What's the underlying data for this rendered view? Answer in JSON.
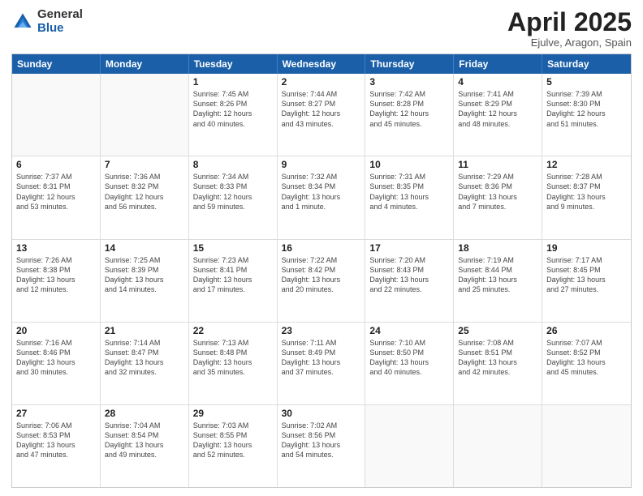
{
  "header": {
    "logo_general": "General",
    "logo_blue": "Blue",
    "month_title": "April 2025",
    "location": "Ejulve, Aragon, Spain"
  },
  "weekdays": [
    "Sunday",
    "Monday",
    "Tuesday",
    "Wednesday",
    "Thursday",
    "Friday",
    "Saturday"
  ],
  "rows": [
    [
      {
        "day": "",
        "info": ""
      },
      {
        "day": "",
        "info": ""
      },
      {
        "day": "1",
        "info": "Sunrise: 7:45 AM\nSunset: 8:26 PM\nDaylight: 12 hours\nand 40 minutes."
      },
      {
        "day": "2",
        "info": "Sunrise: 7:44 AM\nSunset: 8:27 PM\nDaylight: 12 hours\nand 43 minutes."
      },
      {
        "day": "3",
        "info": "Sunrise: 7:42 AM\nSunset: 8:28 PM\nDaylight: 12 hours\nand 45 minutes."
      },
      {
        "day": "4",
        "info": "Sunrise: 7:41 AM\nSunset: 8:29 PM\nDaylight: 12 hours\nand 48 minutes."
      },
      {
        "day": "5",
        "info": "Sunrise: 7:39 AM\nSunset: 8:30 PM\nDaylight: 12 hours\nand 51 minutes."
      }
    ],
    [
      {
        "day": "6",
        "info": "Sunrise: 7:37 AM\nSunset: 8:31 PM\nDaylight: 12 hours\nand 53 minutes."
      },
      {
        "day": "7",
        "info": "Sunrise: 7:36 AM\nSunset: 8:32 PM\nDaylight: 12 hours\nand 56 minutes."
      },
      {
        "day": "8",
        "info": "Sunrise: 7:34 AM\nSunset: 8:33 PM\nDaylight: 12 hours\nand 59 minutes."
      },
      {
        "day": "9",
        "info": "Sunrise: 7:32 AM\nSunset: 8:34 PM\nDaylight: 13 hours\nand 1 minute."
      },
      {
        "day": "10",
        "info": "Sunrise: 7:31 AM\nSunset: 8:35 PM\nDaylight: 13 hours\nand 4 minutes."
      },
      {
        "day": "11",
        "info": "Sunrise: 7:29 AM\nSunset: 8:36 PM\nDaylight: 13 hours\nand 7 minutes."
      },
      {
        "day": "12",
        "info": "Sunrise: 7:28 AM\nSunset: 8:37 PM\nDaylight: 13 hours\nand 9 minutes."
      }
    ],
    [
      {
        "day": "13",
        "info": "Sunrise: 7:26 AM\nSunset: 8:38 PM\nDaylight: 13 hours\nand 12 minutes."
      },
      {
        "day": "14",
        "info": "Sunrise: 7:25 AM\nSunset: 8:39 PM\nDaylight: 13 hours\nand 14 minutes."
      },
      {
        "day": "15",
        "info": "Sunrise: 7:23 AM\nSunset: 8:41 PM\nDaylight: 13 hours\nand 17 minutes."
      },
      {
        "day": "16",
        "info": "Sunrise: 7:22 AM\nSunset: 8:42 PM\nDaylight: 13 hours\nand 20 minutes."
      },
      {
        "day": "17",
        "info": "Sunrise: 7:20 AM\nSunset: 8:43 PM\nDaylight: 13 hours\nand 22 minutes."
      },
      {
        "day": "18",
        "info": "Sunrise: 7:19 AM\nSunset: 8:44 PM\nDaylight: 13 hours\nand 25 minutes."
      },
      {
        "day": "19",
        "info": "Sunrise: 7:17 AM\nSunset: 8:45 PM\nDaylight: 13 hours\nand 27 minutes."
      }
    ],
    [
      {
        "day": "20",
        "info": "Sunrise: 7:16 AM\nSunset: 8:46 PM\nDaylight: 13 hours\nand 30 minutes."
      },
      {
        "day": "21",
        "info": "Sunrise: 7:14 AM\nSunset: 8:47 PM\nDaylight: 13 hours\nand 32 minutes."
      },
      {
        "day": "22",
        "info": "Sunrise: 7:13 AM\nSunset: 8:48 PM\nDaylight: 13 hours\nand 35 minutes."
      },
      {
        "day": "23",
        "info": "Sunrise: 7:11 AM\nSunset: 8:49 PM\nDaylight: 13 hours\nand 37 minutes."
      },
      {
        "day": "24",
        "info": "Sunrise: 7:10 AM\nSunset: 8:50 PM\nDaylight: 13 hours\nand 40 minutes."
      },
      {
        "day": "25",
        "info": "Sunrise: 7:08 AM\nSunset: 8:51 PM\nDaylight: 13 hours\nand 42 minutes."
      },
      {
        "day": "26",
        "info": "Sunrise: 7:07 AM\nSunset: 8:52 PM\nDaylight: 13 hours\nand 45 minutes."
      }
    ],
    [
      {
        "day": "27",
        "info": "Sunrise: 7:06 AM\nSunset: 8:53 PM\nDaylight: 13 hours\nand 47 minutes."
      },
      {
        "day": "28",
        "info": "Sunrise: 7:04 AM\nSunset: 8:54 PM\nDaylight: 13 hours\nand 49 minutes."
      },
      {
        "day": "29",
        "info": "Sunrise: 7:03 AM\nSunset: 8:55 PM\nDaylight: 13 hours\nand 52 minutes."
      },
      {
        "day": "30",
        "info": "Sunrise: 7:02 AM\nSunset: 8:56 PM\nDaylight: 13 hours\nand 54 minutes."
      },
      {
        "day": "",
        "info": ""
      },
      {
        "day": "",
        "info": ""
      },
      {
        "day": "",
        "info": ""
      }
    ]
  ]
}
